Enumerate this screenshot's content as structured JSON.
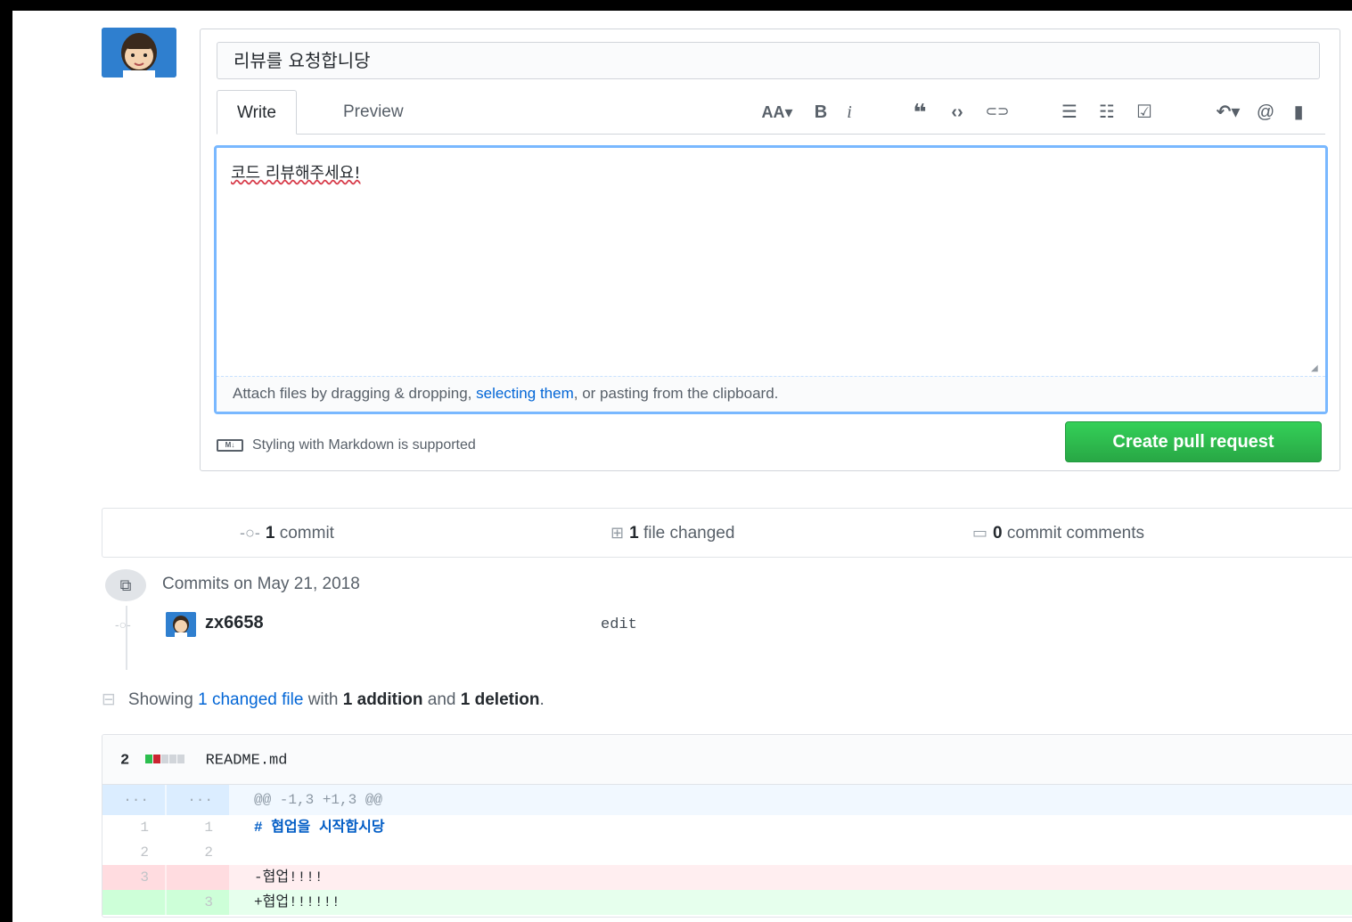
{
  "pr_form": {
    "title_value": "리뷰를 요청합니당",
    "tabs": [
      {
        "label": "Write"
      },
      {
        "label": "Preview"
      }
    ],
    "toolbar": {
      "heading": "AA▾",
      "bold": "B",
      "italic": "i",
      "quote": "❝",
      "code": "‹›",
      "link": "⊂⊃",
      "bullet_list": "☰",
      "numbered_list": "☷",
      "task_list": "☑",
      "reply": "↶▾",
      "mention": "@",
      "bookmark": "▮"
    },
    "body_value": "코드 리뷰해주세요!",
    "attach": {
      "before": "Attach files by dragging & dropping, ",
      "link": "selecting them",
      "after": ", or pasting from the clipboard."
    },
    "markdown_note": "Styling with Markdown is supported",
    "markdown_badge": "M↓",
    "submit_label": "Create pull request"
  },
  "stats": {
    "commits_count": "1",
    "commits_label": "commit",
    "files_count": "1",
    "files_label": "file changed",
    "comments_count": "0",
    "comments_label": "commit comments"
  },
  "commits": {
    "date_label": "Commits on May 21, 2018",
    "items": [
      {
        "author": "zx6658",
        "message": "edit"
      }
    ]
  },
  "summary": {
    "prefix": "Showing ",
    "link": "1 changed file",
    "middle": " with ",
    "additions": "1 addition",
    "and": " and ",
    "deletions": "1 deletion",
    "suffix": "."
  },
  "diff": {
    "changes_count": "2",
    "filename": "README.md",
    "hunk": "@@ -1,3 +1,3 @@",
    "rows": [
      {
        "left": "1",
        "right": "1",
        "code": "# 협업을 시작합시당"
      },
      {
        "left": "2",
        "right": "2",
        "code": ""
      },
      {
        "left": "3",
        "right": "",
        "code": "-협업!!!!"
      },
      {
        "left": "",
        "right": "3",
        "code": "+협업!!!!!!"
      }
    ]
  },
  "colors": {
    "accent_blue": "#0366d6",
    "create_green": "#28a745",
    "add_bg": "#e6ffed",
    "del_bg": "#ffeef0"
  }
}
